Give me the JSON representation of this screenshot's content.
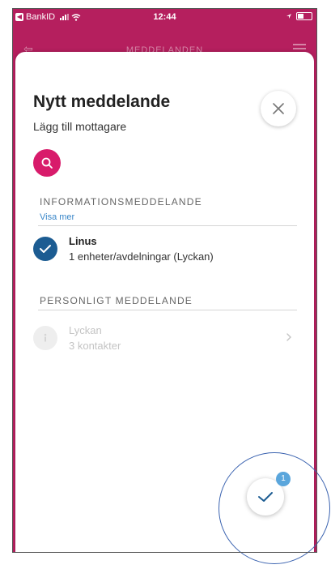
{
  "status_bar": {
    "carrier": "BankID",
    "time": "12:44"
  },
  "nav": {
    "title": "MEDDELANDEN"
  },
  "sheet": {
    "title": "Nytt meddelande",
    "subtitle": "Lägg till mottagare"
  },
  "sections": {
    "information": {
      "header": "INFORMATIONSMEDDELANDE",
      "show_more": "Visa mer",
      "recipient": {
        "name": "Linus",
        "detail": "1 enheter/avdelningar (Lyckan)",
        "selected": true
      }
    },
    "personal": {
      "header": "PERSONLIGT MEDDELANDE",
      "recipient": {
        "name": "Lyckan",
        "detail": "3 kontakter",
        "selected": false
      }
    }
  },
  "confirm": {
    "badge_count": "1"
  },
  "icons": {
    "close": "close-icon",
    "search": "search-icon",
    "check": "check-icon",
    "chevron": "chevron-right-icon"
  },
  "colors": {
    "brand": "#b51f5e",
    "accent": "#d81b6b",
    "selected": "#1c5c92",
    "badge": "#5aa6dc",
    "link": "#3a87c9"
  }
}
